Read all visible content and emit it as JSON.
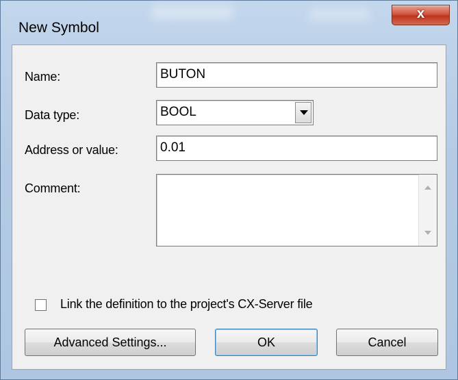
{
  "window": {
    "title": "New Symbol",
    "close_glyph": "x"
  },
  "form": {
    "name_label": "Name:",
    "name_value": "BUTON",
    "datatype_label": "Data type:",
    "datatype_value": "BOOL",
    "address_label": "Address or value:",
    "address_value": "0.01",
    "comment_label": "Comment:",
    "comment_value": "",
    "link_checkbox_label": "Link the definition to the project's CX-Server file",
    "link_checked": false
  },
  "buttons": {
    "advanced": "Advanced Settings...",
    "ok": "OK",
    "cancel": "Cancel"
  },
  "icons": [
    "close-icon",
    "dropdown-arrow-icon",
    "scroll-up-icon",
    "scroll-down-icon"
  ]
}
